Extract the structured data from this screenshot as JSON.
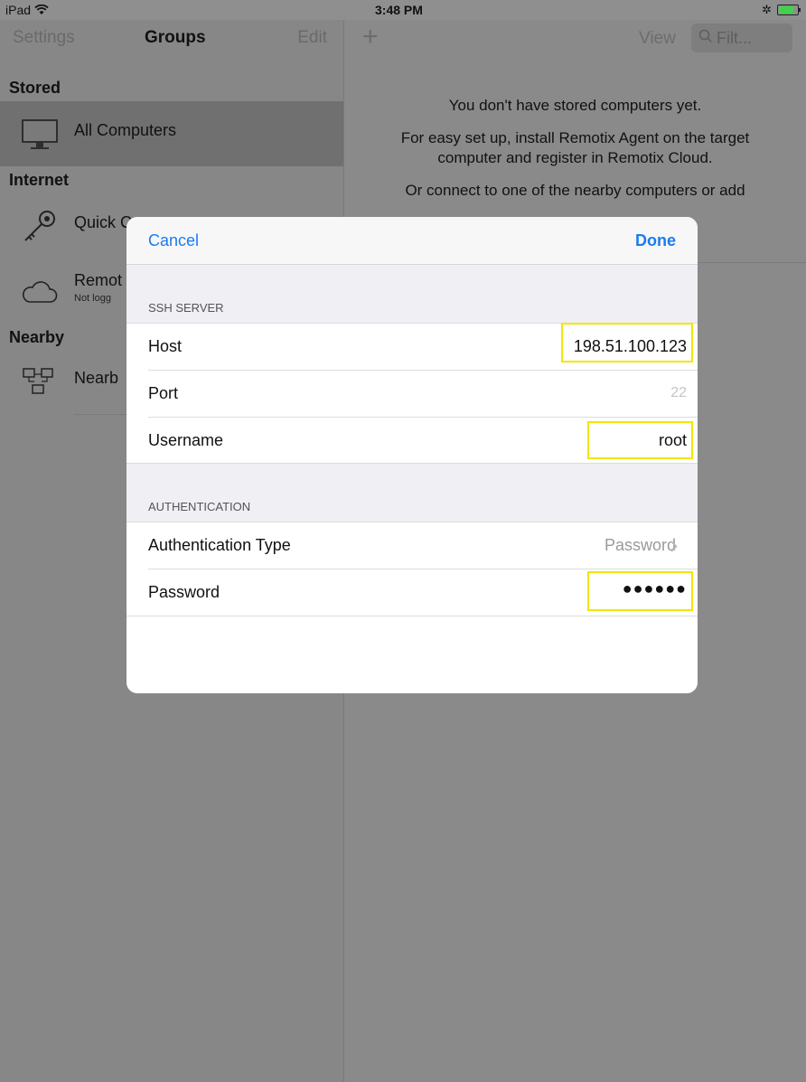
{
  "status_bar": {
    "device": "iPad",
    "time": "3:48 PM"
  },
  "sidebar": {
    "settings": "Settings",
    "title": "Groups",
    "edit": "Edit",
    "sections": {
      "stored": "Stored",
      "internet": "Internet",
      "nearby": "Nearby"
    },
    "items": {
      "all_computers": "All Computers",
      "quick_connect": "Quick C",
      "remotix_cloud": "Remot",
      "remotix_cloud_sub": "Not logg",
      "nearby": "Nearb"
    }
  },
  "content": {
    "view": "View",
    "filter_placeholder": "Filt...",
    "empty_line1": "You don't have stored computers yet.",
    "empty_line2": "For easy set up, install Remotix Agent on the target computer and register in Remotix Cloud.",
    "empty_line3": "Or connect to one of the nearby computers or add"
  },
  "modal": {
    "cancel": "Cancel",
    "done": "Done",
    "ssh_header": "SSH SERVER",
    "host_label": "Host",
    "host_value": "198.51.100.123",
    "port_label": "Port",
    "port_placeholder": "22",
    "username_label": "Username",
    "username_value": "root",
    "auth_header": "AUTHENTICATION",
    "auth_type_label": "Authentication Type",
    "auth_type_value": "Password",
    "password_label": "Password",
    "password_value": "●●●●●●"
  },
  "colors": {
    "accent": "#1a7cf0",
    "highlight": "#f2e600"
  }
}
